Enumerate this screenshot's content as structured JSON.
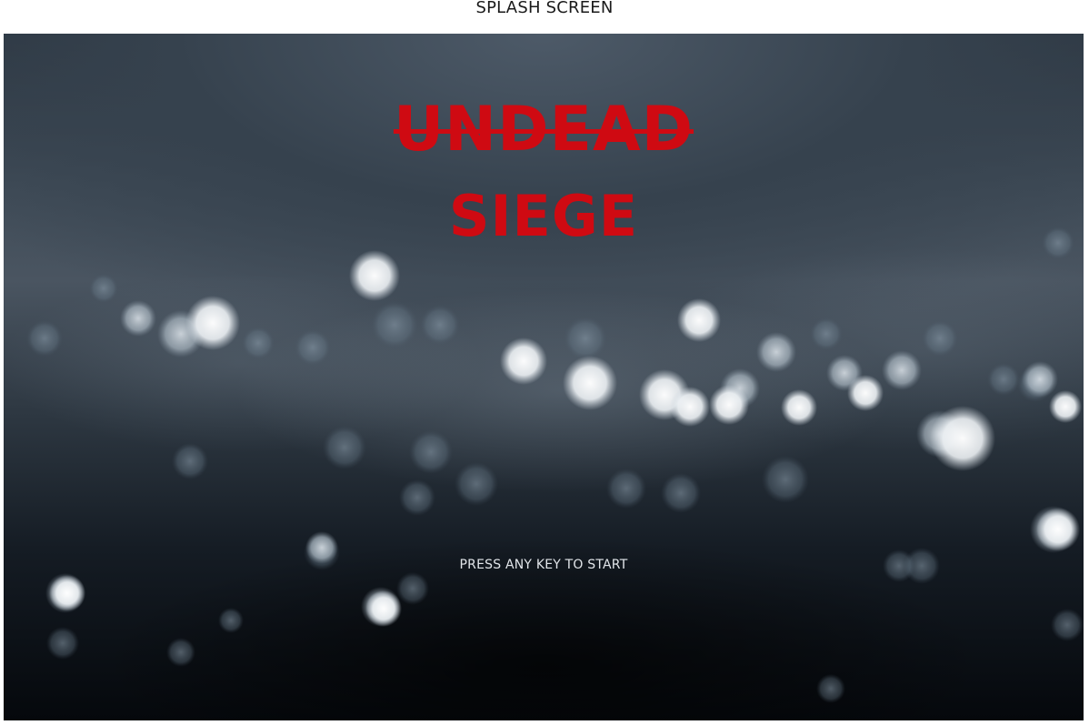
{
  "page": {
    "header_title": "SPLASH SCREEN"
  },
  "game": {
    "title_line1": "UNDEAD",
    "title_line2": "SIEGE",
    "start_prompt": "PRESS ANY KEY TO START",
    "title_color": "#cf0a12",
    "background": "blurred night city bokeh"
  }
}
